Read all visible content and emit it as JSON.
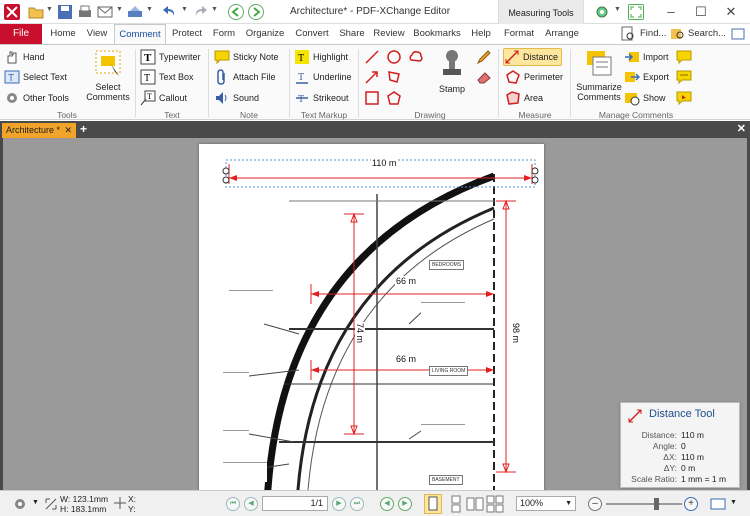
{
  "app": {
    "title": "Architecture* - PDF-XChange Editor",
    "context_tab": "Measuring Tools",
    "find_label": "Find...",
    "search_label": "Search..."
  },
  "tabs": [
    "File",
    "Home",
    "View",
    "Comment",
    "Protect",
    "Form",
    "Organize",
    "Convert",
    "Share",
    "Review",
    "Bookmarks",
    "Help",
    "Format",
    "Arrange"
  ],
  "active_tab": "Comment",
  "ribbon": {
    "tools": {
      "hand": "Hand",
      "select_text": "Select Text",
      "other_tools": "Other Tools",
      "select_comments_1": "Select",
      "select_comments_2": "Comments",
      "group": "Tools"
    },
    "text": {
      "typewriter": "Typewriter",
      "text_box": "Text Box",
      "callout": "Callout",
      "group": "Text"
    },
    "note": {
      "sticky_note": "Sticky Note",
      "attach_file": "Attach File",
      "sound": "Sound",
      "group": "Note"
    },
    "markup": {
      "highlight": "Highlight",
      "underline": "Underline",
      "strikeout": "Strikeout",
      "group": "Text Markup"
    },
    "drawing": {
      "stamp": "Stamp",
      "group": "Drawing"
    },
    "measure": {
      "distance": "Distance",
      "perimeter": "Perimeter",
      "area": "Area",
      "group": "Measure"
    },
    "manage": {
      "summarize_1": "Summarize",
      "summarize_2": "Comments",
      "import": "Import",
      "export": "Export",
      "show": "Show",
      "group": "Manage Comments"
    }
  },
  "document": {
    "tab_label": "Architecture *",
    "measurements": {
      "top": "110 m",
      "upper": "66 m",
      "lower": "66 m",
      "vertical_left": "74 m",
      "vertical_right": "98 m"
    },
    "rooms": {
      "bedrooms": "BEDROOMS",
      "living_room": "LIVING ROOM",
      "basement": "BASEMENT"
    }
  },
  "distance_panel": {
    "title": "Distance Tool",
    "rows": [
      {
        "key": "Distance:",
        "value": "110 m"
      },
      {
        "key": "Angle:",
        "value": "0"
      },
      {
        "key": "ΔX:",
        "value": "110 m"
      },
      {
        "key": "ΔY:",
        "value": "0 m"
      },
      {
        "key": "Scale Ratio:",
        "value": "1 mm = 1 m"
      }
    ]
  },
  "status": {
    "width": "W: 123.1mm",
    "height": "H: 183.1mm",
    "x": "X:",
    "y": "Y:",
    "page": "1/1",
    "zoom": "100%"
  },
  "colors": {
    "file_tab": "#c8102e",
    "doc_tab": "#f1a32a",
    "measure_red": "#e02020",
    "distance_active": "#fde79e"
  }
}
